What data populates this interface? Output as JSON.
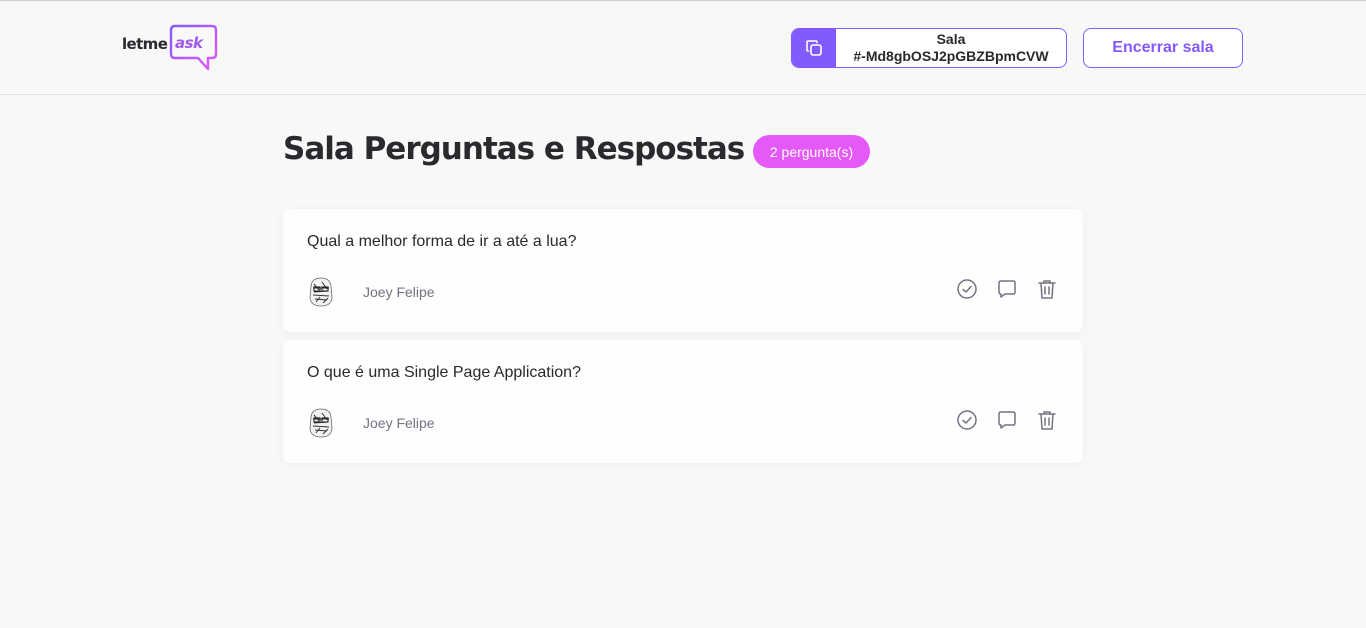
{
  "header": {
    "logo_text_left": "letme",
    "logo_text_right": "ask",
    "room_code": {
      "label": "Sala",
      "code": "#-Md8gbOSJ2pGBZBpmCVW",
      "icon": "copy-icon"
    },
    "end_room_label": "Encerrar sala"
  },
  "main": {
    "title": "Sala Perguntas e Respostas",
    "question_count": "2 pergunta(s)",
    "questions": [
      {
        "content": "Qual a melhor forma de ir a até a lua?",
        "author": "Joey Felipe",
        "actions": [
          "check-icon",
          "answer-icon",
          "delete-icon"
        ]
      },
      {
        "content": "O que é uma Single Page Application?",
        "author": "Joey Felipe",
        "actions": [
          "check-icon",
          "answer-icon",
          "delete-icon"
        ]
      }
    ]
  },
  "colors": {
    "primary": "#835afd",
    "badge": "#e559f9",
    "background": "#f8f8f8",
    "text": "#29292e",
    "muted": "#737380"
  }
}
